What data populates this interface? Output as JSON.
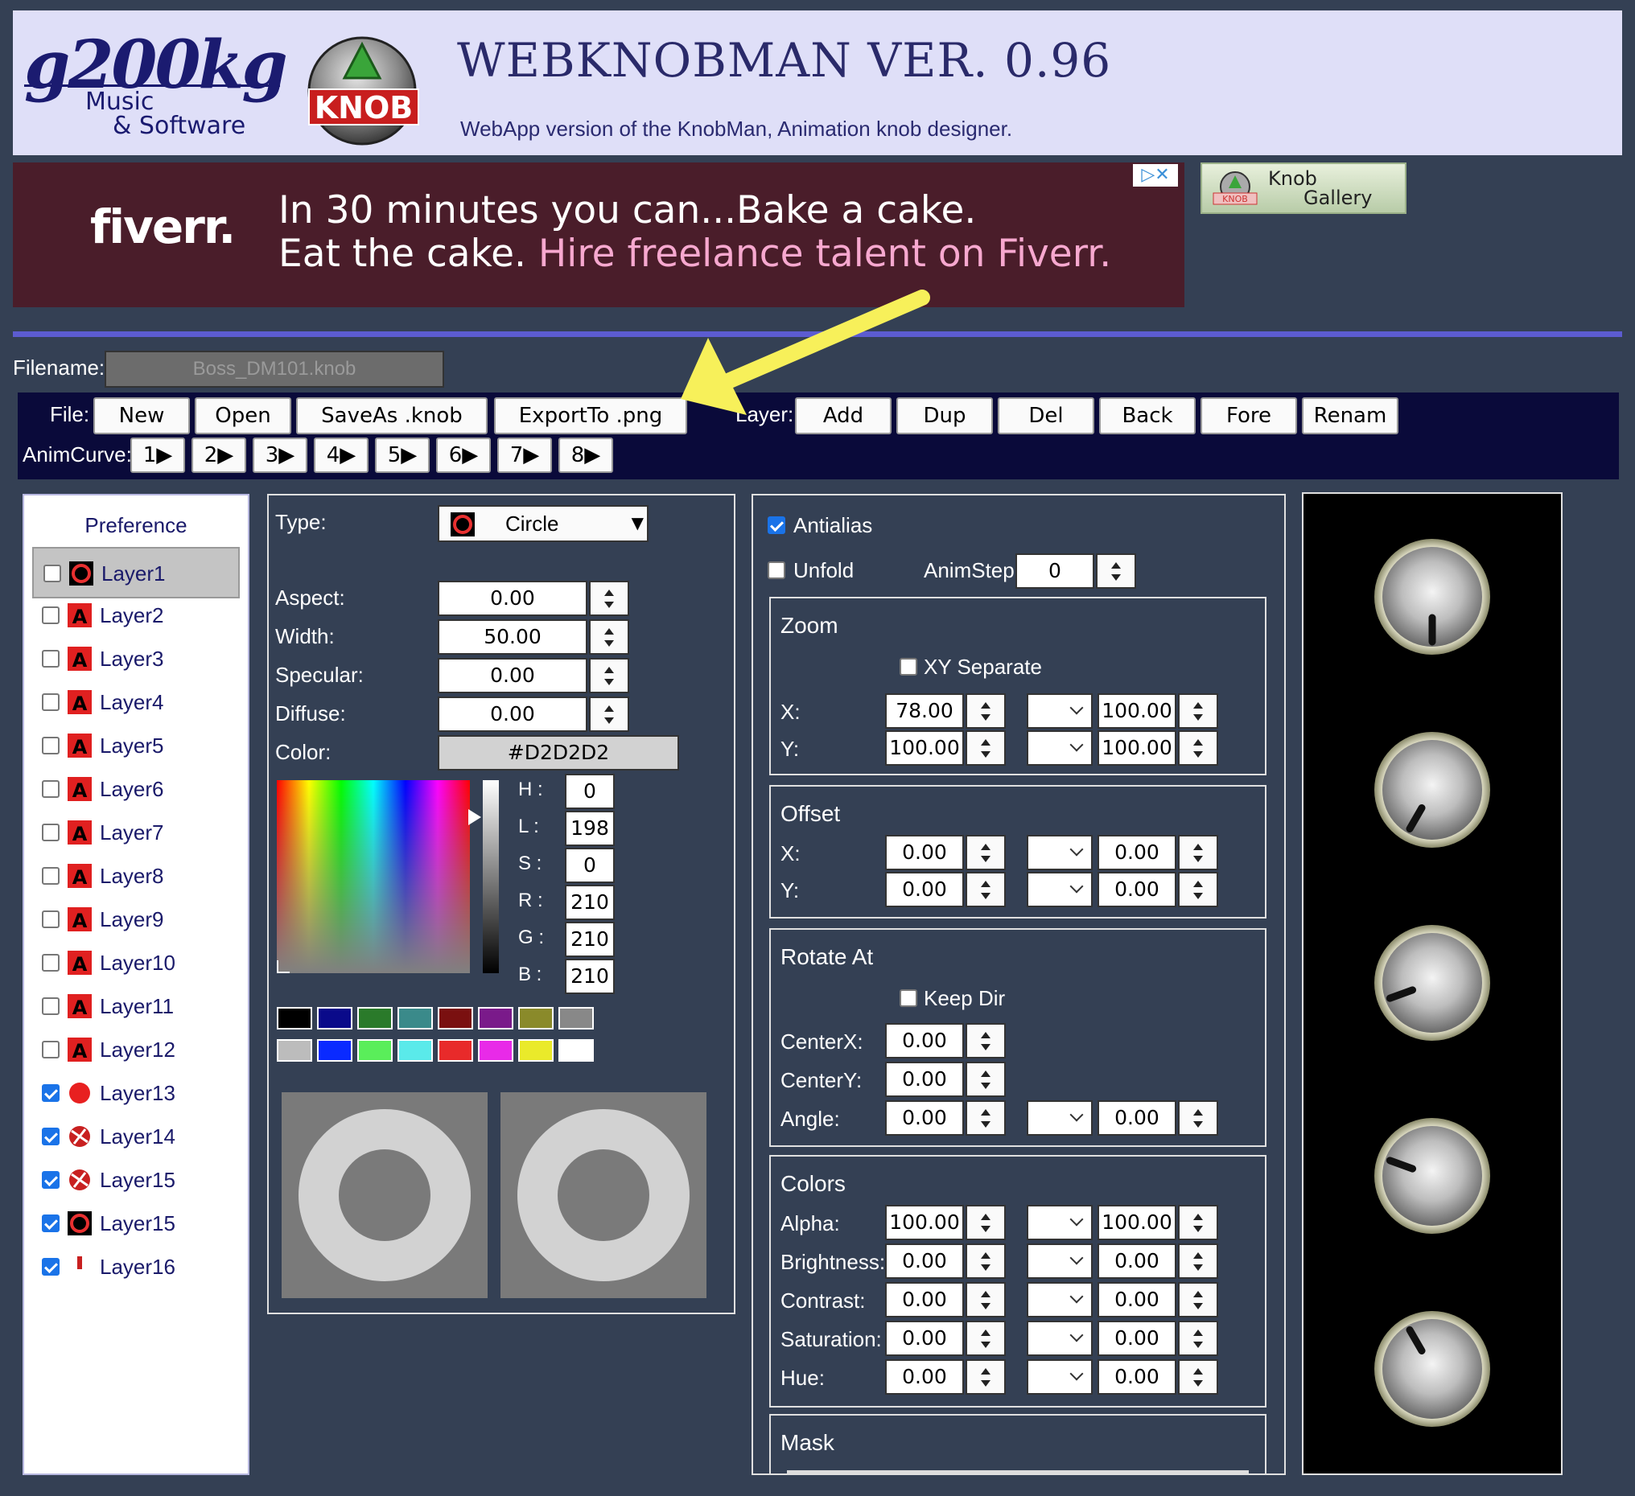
{
  "header": {
    "brand_line1": "g200kg",
    "brand_line2": "Music",
    "brand_line3": "& Software",
    "knob_logo_text": "KNOB",
    "title": "WEBKNOBMAN VER. 0.96",
    "subtitle": "WebApp version of the KnobMan, Animation knob designer."
  },
  "ad": {
    "logo": "fiverr.",
    "line1": "In 30 minutes you can...Bake a cake.",
    "line2_plain": "Eat the cake. ",
    "line2_highlight": "Hire freelance talent on Fiverr.",
    "choices": "▷✕"
  },
  "gallery_button": {
    "line1": "Knob",
    "line2": "Gallery",
    "icon_text": "KNOB"
  },
  "filename": {
    "label": "Filename:",
    "value": "Boss_DM101.knob"
  },
  "toolbar": {
    "file_label": "File:",
    "new": "New",
    "open": "Open",
    "saveas": "SaveAs .knob",
    "export": "ExportTo .png",
    "layer_label": "Layer:",
    "add": "Add",
    "dup": "Dup",
    "del": "Del",
    "back": "Back",
    "fore": "Fore",
    "rename": "Renam",
    "animcurve_label": "AnimCurve:",
    "curves": [
      "1▶",
      "2▶",
      "3▶",
      "4▶",
      "5▶",
      "6▶",
      "7▶",
      "8▶"
    ]
  },
  "layers": {
    "preference": "Preference",
    "items": [
      {
        "label": "Layer1",
        "checked": false,
        "icon": "circle-ring"
      },
      {
        "label": "Layer2",
        "checked": false,
        "icon": "text-A"
      },
      {
        "label": "Layer3",
        "checked": false,
        "icon": "text-A"
      },
      {
        "label": "Layer4",
        "checked": false,
        "icon": "text-A"
      },
      {
        "label": "Layer5",
        "checked": false,
        "icon": "text-A"
      },
      {
        "label": "Layer6",
        "checked": false,
        "icon": "text-A"
      },
      {
        "label": "Layer7",
        "checked": false,
        "icon": "text-A"
      },
      {
        "label": "Layer8",
        "checked": false,
        "icon": "text-A"
      },
      {
        "label": "Layer9",
        "checked": false,
        "icon": "text-A"
      },
      {
        "label": "Layer10",
        "checked": false,
        "icon": "text-A"
      },
      {
        "label": "Layer11",
        "checked": false,
        "icon": "text-A"
      },
      {
        "label": "Layer12",
        "checked": false,
        "icon": "text-A"
      },
      {
        "label": "Layer13",
        "checked": true,
        "icon": "red-circle"
      },
      {
        "label": "Layer14",
        "checked": true,
        "icon": "red-texture"
      },
      {
        "label": "Layer15",
        "checked": true,
        "icon": "red-texture"
      },
      {
        "label": "Layer15",
        "checked": true,
        "icon": "circle-ring"
      },
      {
        "label": "Layer16",
        "checked": true,
        "icon": "knob-line"
      }
    ]
  },
  "props": {
    "type_label": "Type:",
    "type_value": "Circle",
    "aspect_label": "Aspect:",
    "aspect": "0.00",
    "width_label": "Width:",
    "width": "50.00",
    "specular_label": "Specular:",
    "specular": "0.00",
    "diffuse_label": "Diffuse:",
    "diffuse": "0.00",
    "color_label": "Color:",
    "color": "#D2D2D2",
    "h_label": "H :",
    "h": "0",
    "l_label": "L :",
    "l": "198",
    "s_label": "S :",
    "s": "0",
    "r_label": "R :",
    "r": "210",
    "g_label": "G :",
    "g": "210",
    "b_label": "B :",
    "b": "210",
    "swatches": [
      "#000000",
      "#0a0a8a",
      "#2a7a2a",
      "#3a8a8a",
      "#7a1010",
      "#7a1a8a",
      "#8a8a2a",
      "#888888",
      "#bcbcbc",
      "#0a2aff",
      "#5aee5a",
      "#5aeaea",
      "#e82a2a",
      "#e82ae8",
      "#eaea2a",
      "#ffffff"
    ]
  },
  "anim": {
    "antialias": "Antialias",
    "unfold": "Unfold",
    "animstep_label": "AnimStep:",
    "animstep": "0",
    "zoom": {
      "title": "Zoom",
      "xy_separate": "XY Separate",
      "x_label": "X:",
      "y_label": "Y:",
      "x_from": "78.00",
      "x_to": "100.00",
      "y_from": "100.00",
      "y_to": "100.00"
    },
    "offset": {
      "title": "Offset",
      "x_label": "X:",
      "y_label": "Y:",
      "x_from": "0.00",
      "x_to": "0.00",
      "y_from": "0.00",
      "y_to": "0.00"
    },
    "rotate": {
      "title": "Rotate At",
      "keep_dir": "Keep Dir",
      "centerx_label": "CenterX:",
      "centerx": "0.00",
      "centery_label": "CenterY:",
      "centery": "0.00",
      "angle_label": "Angle:",
      "angle_from": "0.00",
      "angle_to": "0.00"
    },
    "colors": {
      "title": "Colors",
      "alpha_label": "Alpha:",
      "alpha_from": "100.00",
      "alpha_to": "100.00",
      "brightness_label": "Brightness:",
      "brightness_from": "0.00",
      "brightness_to": "0.00",
      "contrast_label": "Contrast:",
      "contrast_from": "0.00",
      "contrast_to": "0.00",
      "saturation_label": "Saturation:",
      "saturation_from": "0.00",
      "saturation_to": "0.00",
      "hue_label": "Hue:",
      "hue_from": "0.00",
      "hue_to": "0.00"
    },
    "mask": {
      "title": "Mask"
    }
  },
  "preview": {
    "knob_angles_deg": [
      180,
      210,
      250,
      290,
      330
    ]
  }
}
